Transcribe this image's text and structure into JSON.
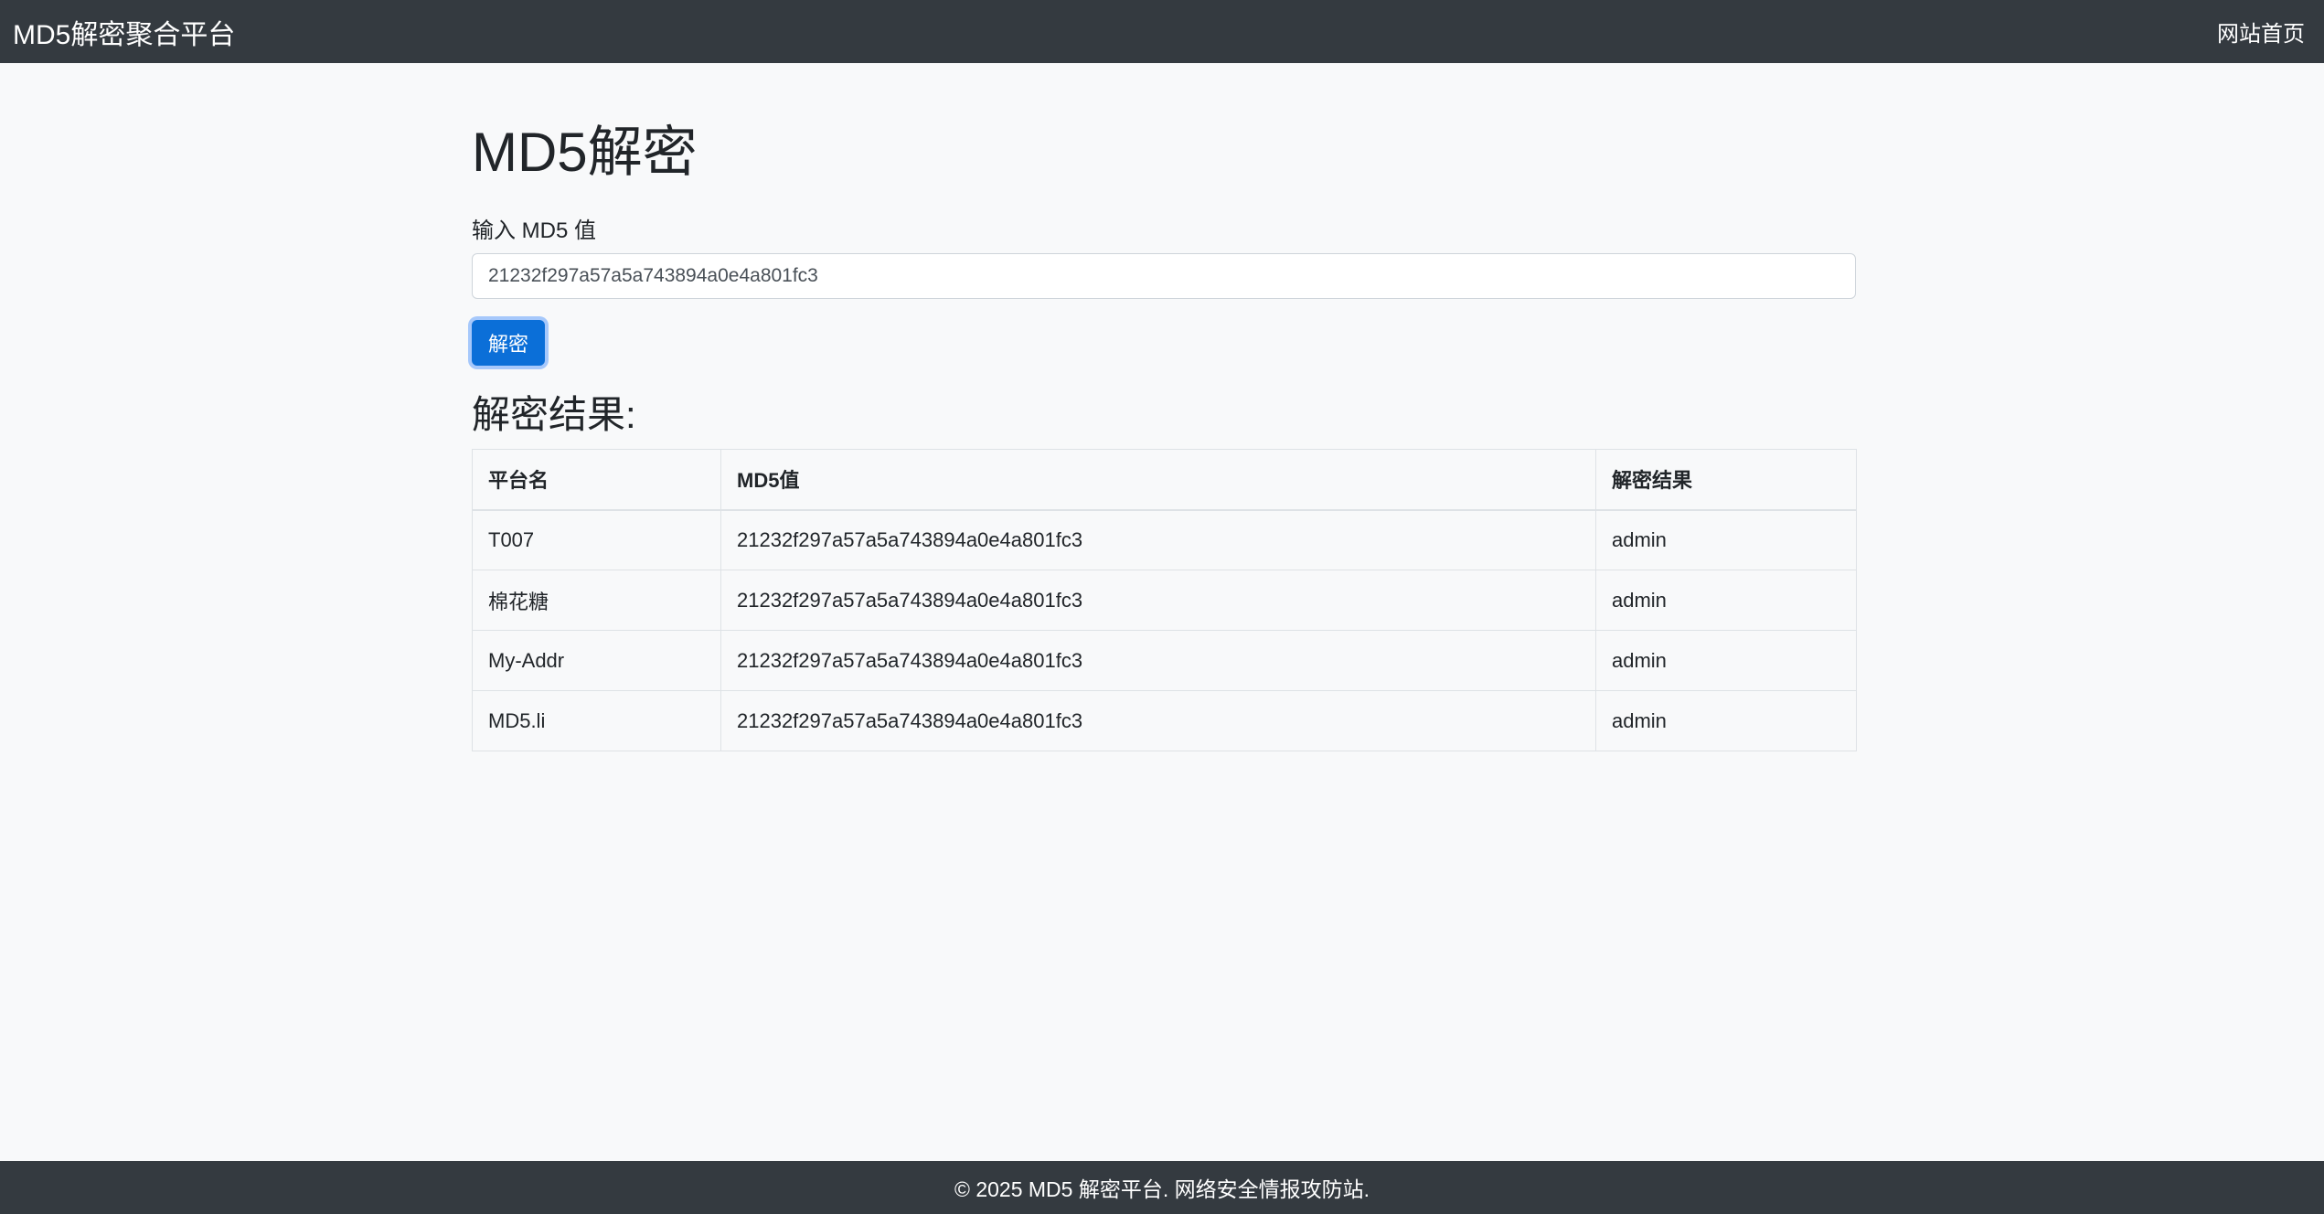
{
  "navbar": {
    "brand": "MD5解密聚合平台",
    "home_link": "网站首页"
  },
  "main": {
    "title": "MD5解密",
    "input_label": "输入 MD5 值",
    "input_value": "21232f297a57a5a743894a0e4a801fc3",
    "decrypt_button": "解密",
    "results_title": "解密结果:",
    "table": {
      "headers": [
        "平台名",
        "MD5值",
        "解密结果"
      ],
      "rows": [
        [
          "T007",
          "21232f297a57a5a743894a0e4a801fc3",
          "admin"
        ],
        [
          "棉花糖",
          "21232f297a57a5a743894a0e4a801fc3",
          "admin"
        ],
        [
          "My-Addr",
          "21232f297a57a5a743894a0e4a801fc3",
          "admin"
        ],
        [
          "MD5.li",
          "21232f297a57a5a743894a0e4a801fc3",
          "admin"
        ]
      ]
    }
  },
  "footer": {
    "text": "© 2025 MD5 解密平台. 网络安全情报攻防站."
  },
  "colors": {
    "navbar_bg": "#343a40",
    "page_bg": "#f8f9fa",
    "primary_button": "#0b6fd8"
  }
}
